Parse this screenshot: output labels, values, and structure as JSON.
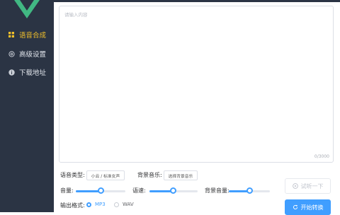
{
  "sidebar": {
    "items": [
      {
        "label": "语音合成",
        "icon": "grid-icon",
        "active": true
      },
      {
        "label": "高级设置",
        "icon": "gear-icon",
        "active": false
      },
      {
        "label": "下载地址",
        "icon": "info-icon",
        "active": false
      }
    ]
  },
  "editor": {
    "placeholder": "请输入内容",
    "counter": "0/3000"
  },
  "settings": {
    "voice_type_label": "语音类型:",
    "voice_type_value": "小云 / 标准女声",
    "bg_music_label": "背景音乐:",
    "bg_music_button": "选择背景音乐",
    "volume_label": "音量:",
    "speed_label": "语速:",
    "bg_volume_label": "背景音量:",
    "volume_level": 0.51,
    "speed_level": 0.5,
    "bg_volume_level": 0.52,
    "format_label": "输出格式:",
    "format_options": [
      "MP3",
      "WAV"
    ],
    "format_selected": "MP3"
  },
  "actions": {
    "preview_label": "试听一下",
    "convert_label": "开始转换"
  },
  "colors": {
    "sidebar_bg": "#2b3444",
    "accent": "#409eff",
    "active_nav": "#f3c12a"
  }
}
